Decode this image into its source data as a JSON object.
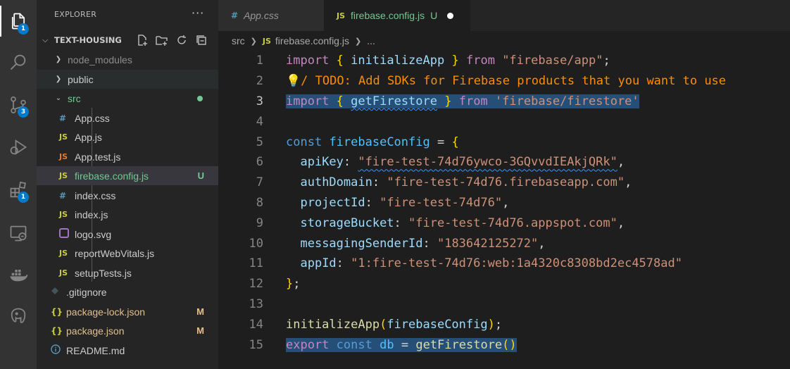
{
  "sidebar": {
    "title": "EXPLORER",
    "more": "···",
    "project": "TEXT-HOUSING",
    "items": [
      {
        "label": "node_modules",
        "icon": "",
        "flag": "",
        "style": "dim"
      },
      {
        "label": "public",
        "icon": "",
        "flag": "",
        "style": ""
      },
      {
        "label": "src",
        "icon": "",
        "flag": "",
        "style": "green"
      },
      {
        "label": "App.css",
        "icon": "#",
        "flag": "",
        "style": ""
      },
      {
        "label": "App.js",
        "icon": "JS",
        "flag": "",
        "style": ""
      },
      {
        "label": "App.test.js",
        "icon": "JS",
        "flag": "",
        "style": "orange"
      },
      {
        "label": "firebase.config.js",
        "icon": "JS",
        "flag": "U",
        "style": "green"
      },
      {
        "label": "index.css",
        "icon": "#",
        "flag": "",
        "style": ""
      },
      {
        "label": "index.js",
        "icon": "JS",
        "flag": "",
        "style": ""
      },
      {
        "label": "logo.svg",
        "icon": "",
        "flag": "",
        "style": ""
      },
      {
        "label": "reportWebVitals.js",
        "icon": "JS",
        "flag": "",
        "style": ""
      },
      {
        "label": "setupTests.js",
        "icon": "JS",
        "flag": "",
        "style": ""
      },
      {
        "label": ".gitignore",
        "icon": "",
        "flag": "",
        "style": ""
      },
      {
        "label": "package-lock.json",
        "icon": "{}",
        "flag": "M",
        "style": "tan"
      },
      {
        "label": "package.json",
        "icon": "{}",
        "flag": "M",
        "style": "tan"
      },
      {
        "label": "README.md",
        "icon": "i",
        "flag": "",
        "style": ""
      }
    ]
  },
  "activity": {
    "explorer_badge": "1",
    "scm_badge": "3",
    "extensions_badge": "1"
  },
  "tabs": [
    {
      "icon": "#",
      "label": "App.css"
    },
    {
      "icon": "JS",
      "label": "firebase.config.js",
      "flag": "U"
    }
  ],
  "breadcrumb": {
    "folder": "src",
    "icon": "JS",
    "file": "firebase.config.js",
    "more": "..."
  },
  "code": {
    "line_numbers": [
      "1",
      "2",
      "3",
      "4",
      "5",
      "6",
      "7",
      "8",
      "9",
      "10",
      "11",
      "12",
      "13",
      "14",
      "15"
    ],
    "l1": {
      "kw": "import",
      "b1": "{",
      "name": "initializeApp",
      "b2": "}",
      "from": "from",
      "src": "\"firebase/app\"",
      "end": ";"
    },
    "l2": {
      "text": "/ TODO: Add SDKs for Firebase products that you want to use"
    },
    "l3": {
      "kw": "import",
      "b1": "{",
      "name": "getFirestore",
      "b2": "}",
      "from": "from",
      "src": "'firebase/firestore'"
    },
    "l5": {
      "kw": "const",
      "name": "firebaseConfig",
      "eq": "=",
      "brace": "{"
    },
    "l6": {
      "key": "apiKey",
      "val": "\"fire-test-74d76ywco-3GQvvdIEAkjQRk\"",
      "end": ","
    },
    "l7": {
      "key": "authDomain",
      "val": "\"fire-test-74d76.firebaseapp.com\"",
      "end": ","
    },
    "l8": {
      "key": "projectId",
      "val": "\"fire-test-74d76\"",
      "end": ","
    },
    "l9": {
      "key": "storageBucket",
      "val": "\"fire-test-74d76.appspot.com\"",
      "end": ","
    },
    "l10": {
      "key": "messagingSenderId",
      "val": "\"183642125272\"",
      "end": ","
    },
    "l11": {
      "key": "appId",
      "val": "\"1:fire-test-74d76:web:1a4320c8308bd2ec4578ad\""
    },
    "l12": {
      "brace": "}",
      "end": ";"
    },
    "l14": {
      "fn": "initializeApp",
      "p1": "(",
      "arg": "firebaseConfig",
      "p2": ")",
      "end": ";"
    },
    "l15": {
      "kw1": "export",
      "kw2": "const",
      "name": "db",
      "eq": "=",
      "fn": "getFirestore",
      "parens": "()"
    }
  }
}
